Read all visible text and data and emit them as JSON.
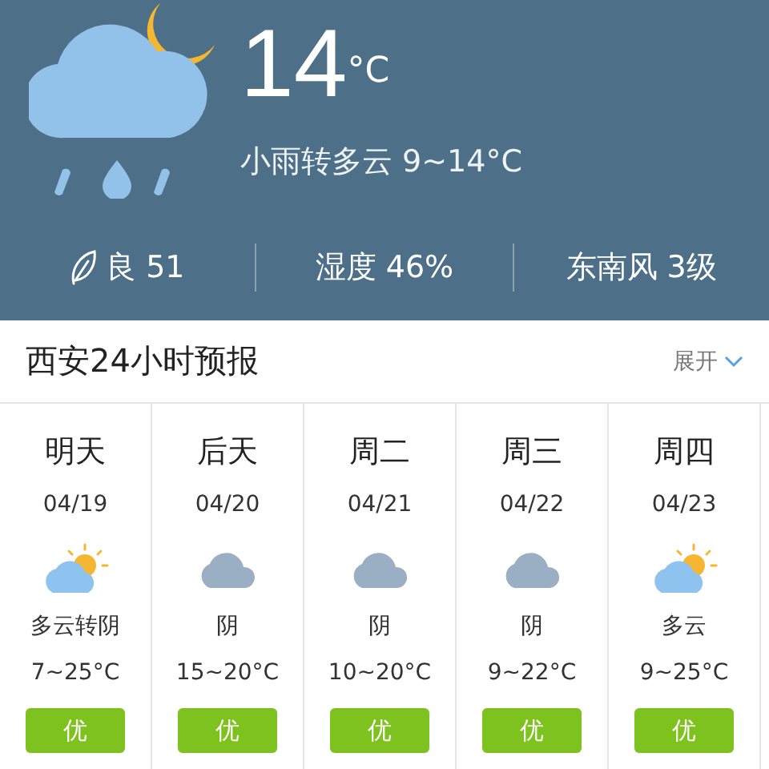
{
  "current": {
    "temperature": "14",
    "unit": "°C",
    "summary": "小雨转多云 9~14°C"
  },
  "stats": [
    {
      "kind": "aqi",
      "text": "良 51"
    },
    {
      "kind": "plain",
      "text": "湿度 46%"
    },
    {
      "kind": "plain",
      "text": "东南风 3级"
    }
  ],
  "forecast": {
    "title": "西安24小时预报",
    "expand": "展开",
    "days": [
      {
        "day": "明天",
        "date": "04/19",
        "kind": "partly_cloudy",
        "desc": "多云转阴",
        "temp": "7~25°C",
        "aqi": "优",
        "color": "#7dc21e"
      },
      {
        "day": "后天",
        "date": "04/20",
        "kind": "overcast",
        "desc": "阴",
        "temp": "15~20°C",
        "aqi": "优",
        "color": "#7dc21e"
      },
      {
        "day": "周二",
        "date": "04/21",
        "kind": "overcast",
        "desc": "阴",
        "temp": "10~20°C",
        "aqi": "优",
        "color": "#7dc21e"
      },
      {
        "day": "周三",
        "date": "04/22",
        "kind": "overcast",
        "desc": "阴",
        "temp": "9~22°C",
        "aqi": "优",
        "color": "#7dc21e"
      },
      {
        "day": "周四",
        "date": "04/23",
        "kind": "partly_cloudy",
        "desc": "多云",
        "temp": "9~25°C",
        "aqi": "优",
        "color": "#7dc21e"
      }
    ]
  }
}
